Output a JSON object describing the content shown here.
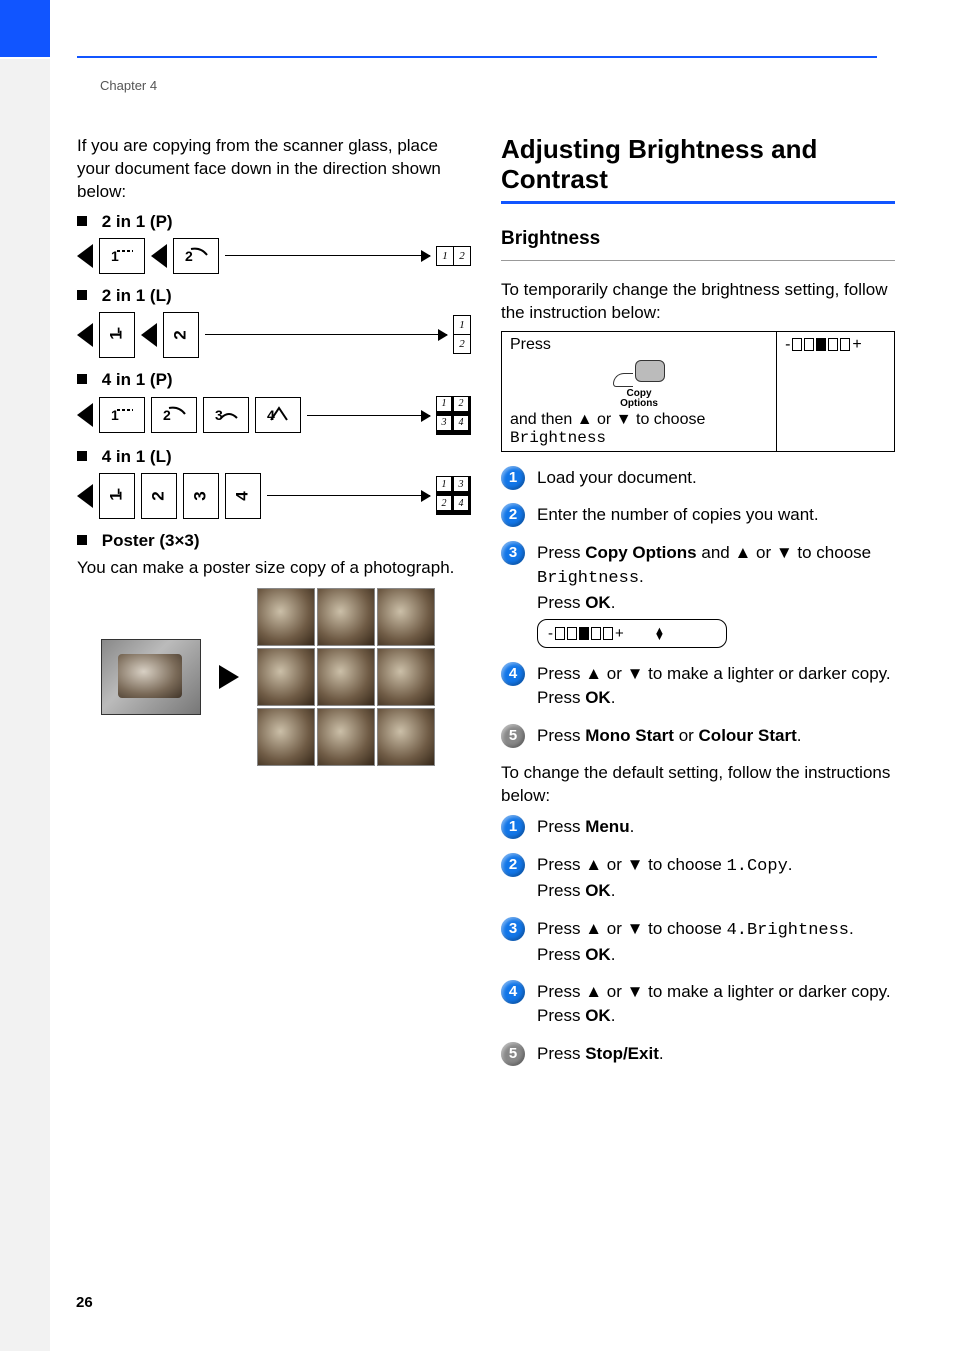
{
  "chapter_label": "Chapter 4",
  "page_number": "26",
  "left": {
    "intro": "If you are copying from the scanner glass, place your document face down in the direction shown below:",
    "opt_2in1_p": "2 in 1 (P)",
    "opt_2in1_l": "2 in 1 (L)",
    "opt_4in1_p": "4 in 1 (P)",
    "opt_4in1_l": "4 in 1 (L)",
    "opt_poster": "Poster (3×3)",
    "poster_desc": "You can make a poster size copy of a photograph.",
    "cells": {
      "n1": "1",
      "n2": "2",
      "n3": "3",
      "n4": "4"
    }
  },
  "right": {
    "h2": "Adjusting Brightness and Contrast",
    "h3_brightness": "Brightness",
    "brightness_intro": "To temporarily change the brightness setting, follow the instruction below:",
    "panel": {
      "press": "Press",
      "seg_display": "-▯▯▮▯▯+",
      "copy_label_l1": "Copy",
      "copy_label_l2": "Options",
      "and_then_a": "and then ",
      "and_then_b": " or ",
      "and_then_c": " to choose ",
      "brightness_mono": "Brightness"
    },
    "stepsA": {
      "s1": "Load your document.",
      "s2": "Enter the number of copies you want.",
      "s3_a": "Press ",
      "s3_copyopt": "Copy Options",
      "s3_b": " and ",
      "s3_c": " or ",
      "s3_d": " to choose ",
      "s3_bright": "Brightness",
      "s3_e": ".",
      "s3_ok": "OK",
      "press_word": "Press ",
      "lcd_text": "-▯▯▮▯▯+",
      "s4_a": "Press ",
      "s4_b": " or ",
      "s4_c": " to make a lighter or darker copy.",
      "s5_a": "Press ",
      "s5_mono": "Mono Start",
      "s5_or": " or ",
      "s5_colour": "Colour Start",
      "s5_dot": "."
    },
    "default_intro": "To change the default setting, follow the instructions below:",
    "stepsB": {
      "s1_a": "Press ",
      "s1_menu": "Menu",
      "s1_dot": ".",
      "s2_a": "Press ",
      "s2_b": " or ",
      "s2_c": " to choose ",
      "s2_mono": "1.Copy",
      "s2_d": ".",
      "ok": "OK",
      "s3_a": "Press ",
      "s3_b": " or ",
      "s3_c": " to choose ",
      "s3_mono": "4.Brightness",
      "s3_d": ".",
      "s4_a": "Press ",
      "s4_b": " or ",
      "s4_c": " to make a lighter or darker copy.",
      "s5_a": "Press ",
      "s5_stop": "Stop/Exit",
      "s5_dot": "."
    },
    "arrow_up": "▲",
    "arrow_down": "▼"
  }
}
